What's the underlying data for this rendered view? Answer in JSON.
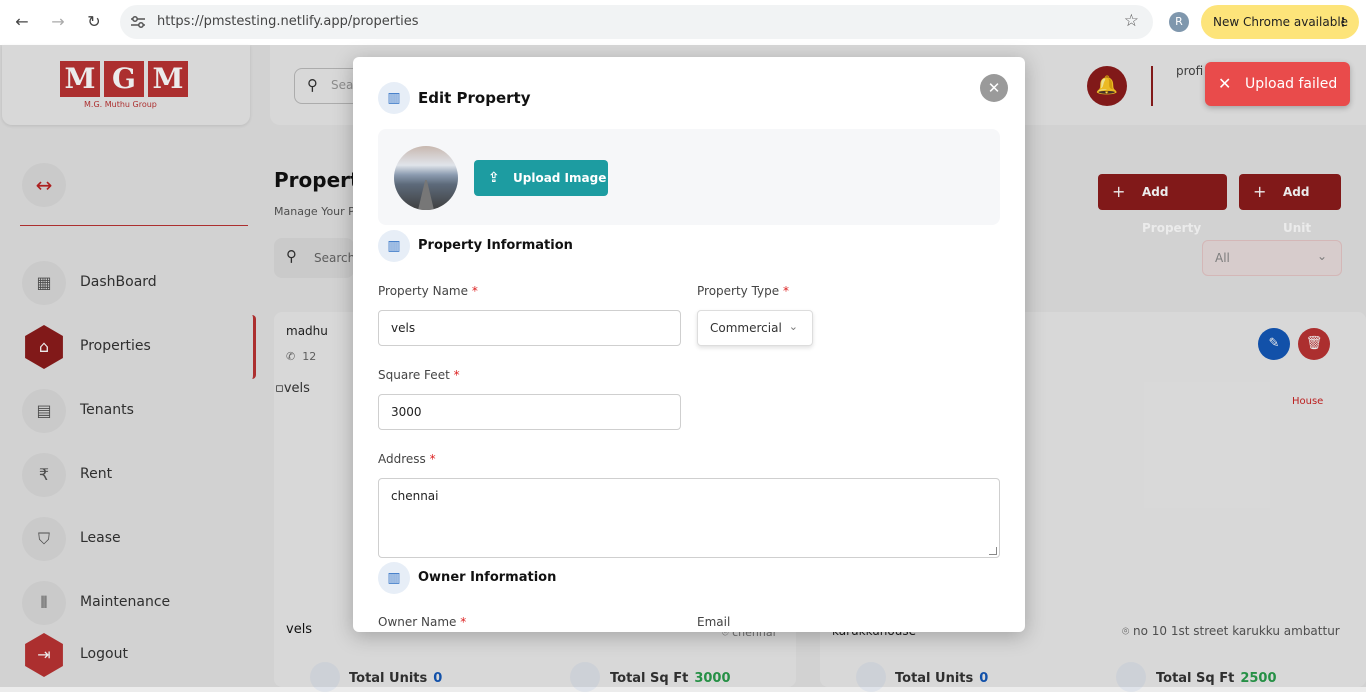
{
  "browser": {
    "url": "https://pmstesting.netlify.app/properties",
    "profile_initial": "R",
    "update_label": "New Chrome available"
  },
  "brand": {
    "logo_letters": [
      "M",
      "G",
      "M"
    ],
    "subtitle": "M.G. Muthu Group"
  },
  "topbar": {
    "search_placeholder": "Sea",
    "profile_alt": "profi"
  },
  "toast": {
    "message": "Upload failed"
  },
  "sidebar": {
    "items": [
      {
        "label": "DashBoard",
        "icon": "dashboard-icon"
      },
      {
        "label": "Properties",
        "icon": "properties-icon",
        "active": true
      },
      {
        "label": "Tenants",
        "icon": "document-icon"
      },
      {
        "label": "Rent",
        "icon": "rupee-icon"
      },
      {
        "label": "Lease",
        "icon": "handshake-icon"
      },
      {
        "label": "Maintenance",
        "icon": "waveform-icon"
      },
      {
        "label": "Logout",
        "icon": "logout-icon"
      }
    ]
  },
  "main": {
    "title": "Properties",
    "subtitle": "Manage Your Properties",
    "search_placeholder": "Search",
    "add_property": "Add Property",
    "add_unit": "Add Unit",
    "filter_value": "All"
  },
  "cards": [
    {
      "owner": "madhu",
      "phone": "12",
      "img_alt": "vels",
      "name": "vels",
      "location": "chennai",
      "units_label": "Total Units",
      "units": "0",
      "sqft_label": "Total Sq Ft",
      "sqft": "3000"
    },
    {
      "tag": "House",
      "name": "karukkuhouse",
      "location": "no 10 1st street karukku ambattur",
      "units_label": "Total Units",
      "units": "0",
      "sqft_label": "Total Sq Ft",
      "sqft": "2500"
    }
  ],
  "modal": {
    "title": "Edit Property",
    "upload_label": "Upload Image",
    "section_property": "Property Information",
    "property_name_label": "Property Name",
    "property_name": "vels",
    "property_type_label": "Property Type",
    "property_type": "Commercial",
    "square_feet_label": "Square Feet",
    "square_feet": "3000",
    "address_label": "Address",
    "address": "chennai",
    "section_owner": "Owner Information",
    "owner_name_label": "Owner Name",
    "email_label": "Email",
    "required_mark": "*"
  },
  "colors": {
    "brand": "#8c1c1c",
    "accent_teal": "#1d9ca1",
    "toast": "#e94b4b",
    "edit": "#1458b8"
  }
}
